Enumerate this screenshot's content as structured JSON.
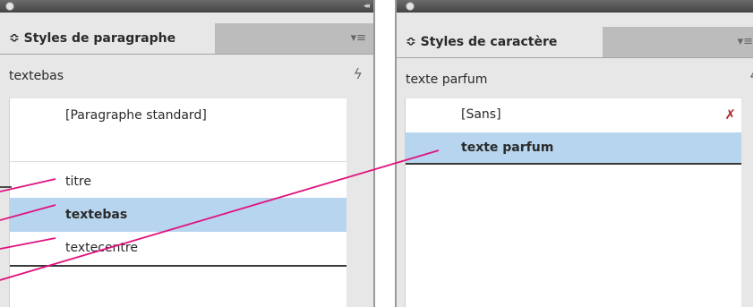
{
  "paragraph_panel": {
    "tab_label": "≎ Styles de paragraphe",
    "menu_icon": "≡",
    "current_style": "textebas",
    "styles": [
      "[Paragraphe standard]",
      "titre",
      "textebas",
      "textecentre"
    ]
  },
  "character_panel": {
    "tab_label": "≎ Styles de caractère",
    "menu_icon": "≡",
    "current_style": "texte parfum",
    "styles": [
      "[Sans]",
      "texte parfum"
    ]
  },
  "colors": {
    "selection": "#b7d5ef",
    "callout": "#e0127f",
    "panel_bg": "#e7e7e7"
  }
}
